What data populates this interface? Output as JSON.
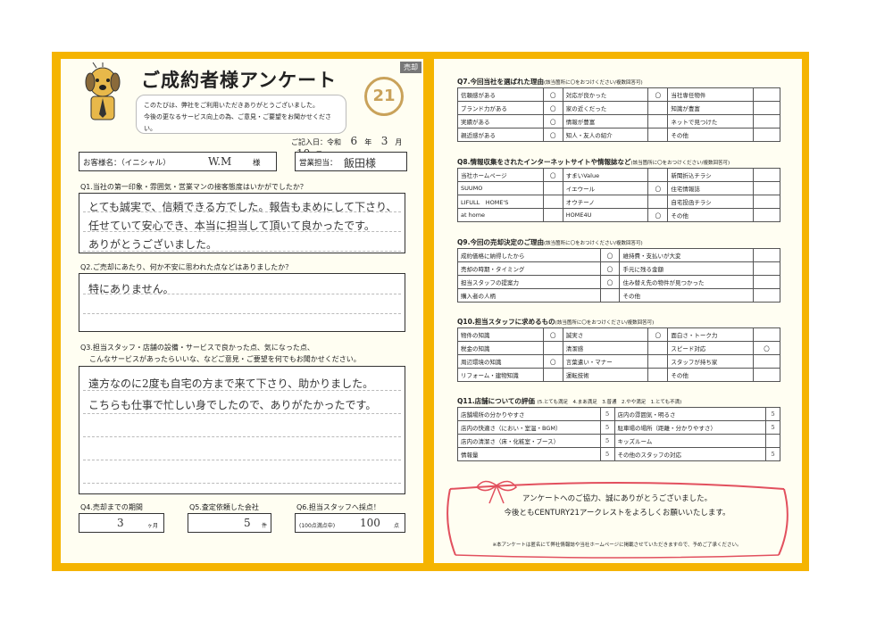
{
  "left": {
    "tag": "売却",
    "title": "ご成約者様アンケート",
    "greeting1": "このたびは、弊社をご利用いただきありがとうございました。",
    "greeting2": "今後の更なるサービス向上の為、ご意見・ご要望をお聞かせください。",
    "logo_text": "21",
    "date_label": "ご記入日：令和",
    "date_year": "6",
    "date_year_unit": "年",
    "date_month": "3",
    "date_month_unit": "月",
    "date_day": "10",
    "date_day_unit": "日",
    "customer_label": "お客様名：（イニシャル）",
    "customer_value": "W.M",
    "customer_suffix": "様",
    "staff_label": "営業担当：",
    "staff_value": "飯田様",
    "q1": "Q1.当社の第一印象・雰囲気・営業マンの接客態度はいかがでしたか？",
    "q1_a1": "とても誠実で、信頼できる方でした。報告もまめにして下さり、",
    "q1_a2": "任せていて安心でき、本当に担当して頂いて良かったです。",
    "q1_a3": "ありがとうございました。",
    "q2": "Q2.ご売却にあたり、何か不安に思われた点などはありましたか？",
    "q2_a1": "特にありません。",
    "q3_1": "Q3.担当スタッフ・店舗の設備・サービスで良かった点、気になった点、",
    "q3_2": "こんなサービスがあったらいいな、などご意見・ご要望を何でもお聞かせください。",
    "q3_a1": "遠方なのに2度も自宅の方まで来て下さり、助かりました。",
    "q3_a2": "こちらも仕事で忙しい身でしたので、ありがたかったです。",
    "q4": "Q4.売却までの期間",
    "q4_value": "3",
    "q4_unit": "ヶ月",
    "q5": "Q5.査定依頼した会社",
    "q5_value": "5",
    "q5_unit": "件",
    "q6": "Q6.担当スタッフへ採点！",
    "q6_note": "(100点満点中)",
    "q6_value": "100",
    "q6_unit": "点"
  },
  "q7": {
    "title": "Q7.今回当社を選ばれた理由",
    "note": "(該当箇所に〇をおつけください/複数回答可)",
    "rows": [
      [
        "信頼感がある",
        "〇",
        "対応が良かった",
        "〇",
        "当社専任物件",
        ""
      ],
      [
        "ブランド力がある",
        "〇",
        "家の近くだった",
        "",
        "知識が豊富",
        ""
      ],
      [
        "実績がある",
        "〇",
        "情報が豊富",
        "",
        "ネットで見つけた",
        ""
      ],
      [
        "親近感がある",
        "〇",
        "知人・友人の紹介",
        "",
        "その他",
        ""
      ]
    ]
  },
  "q8": {
    "title": "Q8.情報収集をされたインターネットサイトや情報誌など",
    "note": "(該当箇所に〇をおつけください/複数回答可)",
    "rows": [
      [
        "当社ホームページ",
        "〇",
        "すまいValue",
        "",
        "新聞折込チラシ",
        ""
      ],
      [
        "SUUMO",
        "",
        "イエウール",
        "〇",
        "住宅情報誌",
        ""
      ],
      [
        "LIFULL　HOME'S",
        "",
        "オウチーノ",
        "",
        "自宅投函チラシ",
        ""
      ],
      [
        "at home",
        "",
        "HOME4U",
        "〇",
        "その他",
        ""
      ]
    ]
  },
  "q9": {
    "title": "Q9.今回の売却決定のご理由",
    "note": "(該当箇所に〇をおつけください/複数回答可)",
    "rows": [
      [
        "成約価格に納得したから",
        "〇",
        "維持費・支払いが大変",
        ""
      ],
      [
        "売却の時期・タイミング",
        "〇",
        "手元に残る金額",
        ""
      ],
      [
        "担当スタッフの提案力",
        "〇",
        "住み替え先の物件が見つかった",
        ""
      ],
      [
        "購入者の人柄",
        "",
        "その他",
        ""
      ]
    ]
  },
  "q10": {
    "title": "Q10.担当スタッフに求めるもの",
    "note": "(該当箇所に〇をおつけください/複数回答可)",
    "rows": [
      [
        "物件の知識",
        "〇",
        "誠実さ",
        "〇",
        "面白さ・トーク力",
        ""
      ],
      [
        "税金の知識",
        "",
        "清潔感",
        "",
        "スピード対応",
        "〇"
      ],
      [
        "周辺環境の知識",
        "〇",
        "言葉遣い・マナー",
        "",
        "スタッフが持ち家",
        ""
      ],
      [
        "リフォーム・建物知識",
        "",
        "運転技術",
        "",
        "その他",
        ""
      ]
    ]
  },
  "q11": {
    "title": "Q11.店舗についての評価",
    "scale": "(5.とても満足　4.まあ満足　3.普通　2.やや満足　1.とても不満)",
    "rows": [
      [
        "店舗場所の分かりやすさ",
        "5",
        "店内の雰囲気・明るさ",
        "5"
      ],
      [
        "店内の快適さ（におい・室温・BGM）",
        "5",
        "駐車場の場所（距離・分かりやすさ）",
        "5"
      ],
      [
        "店内の清潔さ（床・化粧室・ブース）",
        "5",
        "キッズルーム",
        ""
      ],
      [
        "情報量",
        "5",
        "その他のスタッフの対応",
        "5"
      ]
    ]
  },
  "thanks": {
    "line1": "アンケートへのご協力、誠にありがとうございました。",
    "line2": "今後ともCENTURY21アークレストをよろしくお願いいたします。",
    "note": "※本アンケートは匿名にて弊社情報誌や当社ホームページに掲載させていただきますので、予めご了承ください。"
  },
  "colors": {
    "frame": "#f5b400",
    "ribbon": "#e2505e",
    "logo": "#c9a25a"
  }
}
